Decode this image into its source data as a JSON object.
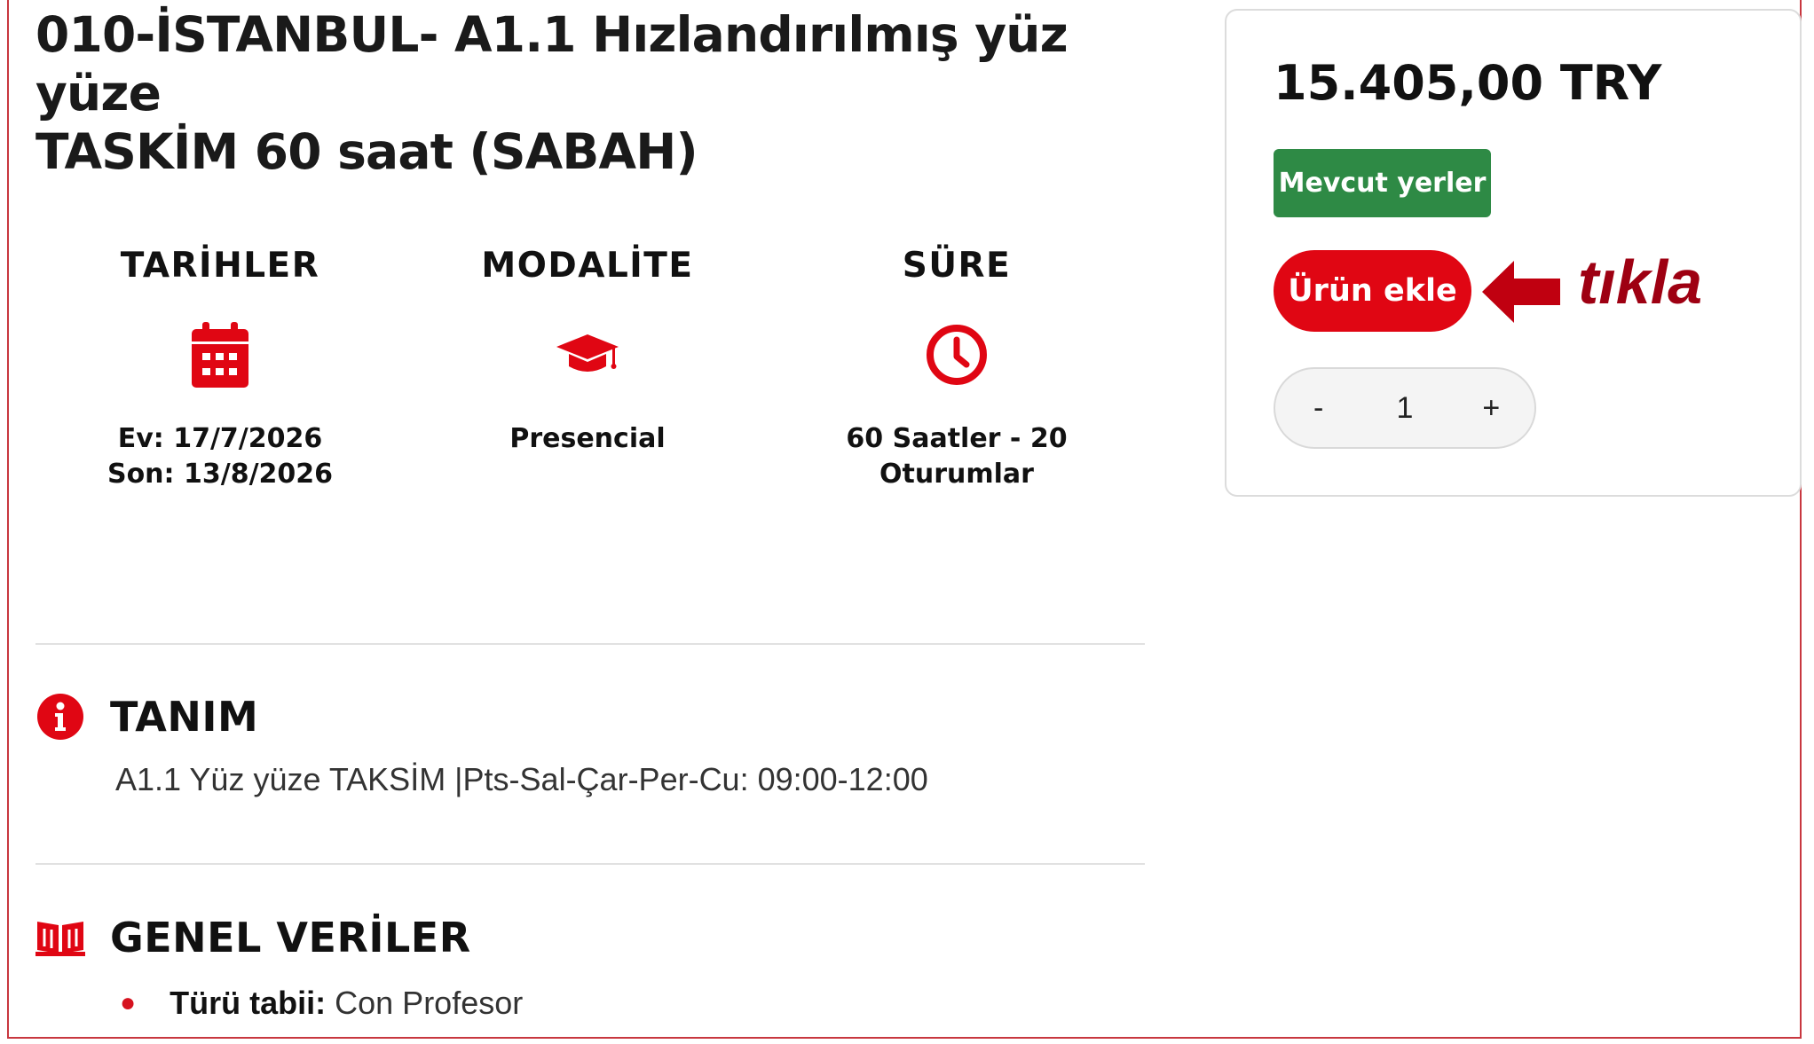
{
  "course": {
    "title_line1": "010-İSTANBUL- A1.1 Hızlandırılmış yüz yüze",
    "title_line2": "TASKİM 60 saat (SABAH)"
  },
  "info": {
    "dates": {
      "heading": "TARİHLER",
      "icon": "calendar-icon",
      "start": "Ev: 17/7/2026",
      "end": "Son: 13/8/2026"
    },
    "modality": {
      "heading": "MODALİTE",
      "icon": "graduation-cap-icon",
      "value": "Presencial"
    },
    "duration": {
      "heading": "SÜRE",
      "icon": "clock-icon",
      "line1": "60 Saatler - 20",
      "line2": "Oturumlar"
    }
  },
  "sections": {
    "description": {
      "heading": "TANIM",
      "icon": "info-icon",
      "text": "A1.1 Yüz yüze TAKSİM |Pts-Sal-Çar-Per-Cu: 09:00-12:00"
    },
    "general": {
      "heading": "GENEL VERİLER",
      "icon": "book-icon",
      "items": [
        {
          "key": "Türü tabii:",
          "value": "Con Profesor"
        }
      ]
    }
  },
  "purchase": {
    "price": "15.405,00 TRY",
    "availability_badge": "Mevcut yerler",
    "add_button": "Ürün ekle",
    "quantity": {
      "minus": "-",
      "value": "1",
      "plus": "+"
    }
  },
  "annotation": {
    "text": "tıkla",
    "icon": "left-arrow-icon"
  },
  "colors": {
    "accent_red": "#e00613",
    "badge_green": "#2e8a45",
    "annotation_red": "#9e0012"
  }
}
